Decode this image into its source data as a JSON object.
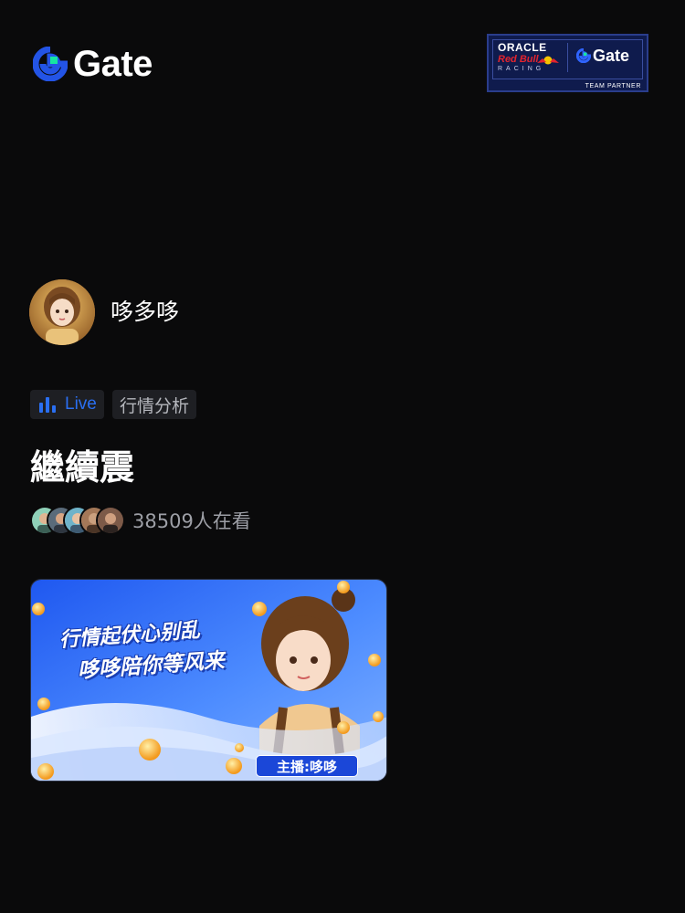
{
  "brand": {
    "name": "Gate",
    "logo_icon": "gate-logo-icon",
    "accent_blue": "#2354e6",
    "accent_green": "#17e6a1"
  },
  "partner_badge": {
    "oracle": "ORACLE",
    "red_bull": "Red Bull",
    "racing": "RACING",
    "gate": "Gate",
    "team_partner": "TEAM PARTNER"
  },
  "host": {
    "name": "哆多哆",
    "avatar_icon": "host-avatar"
  },
  "tags": {
    "live_label": "Live",
    "live_icon": "bar-chart-icon",
    "live_color": "#2a6ff2",
    "category": "行情分析"
  },
  "stream": {
    "title": "繼續震",
    "viewers_text": "38509人在看",
    "viewer_avatar_count_shown": 5
  },
  "banner": {
    "line1": "行情起伏心别乱",
    "line2": "哆哆陪你等风来",
    "host_chip": "主播:哆哆"
  }
}
